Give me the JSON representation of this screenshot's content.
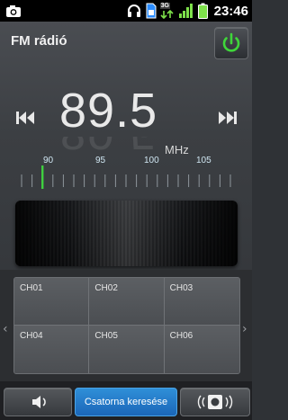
{
  "status_bar": {
    "time": "23:46",
    "network_label": "3G",
    "icons": [
      "camera-icon",
      "headphones-icon",
      "sim-card-icon",
      "network-3g-icon",
      "signal-icon",
      "battery-icon"
    ]
  },
  "app": {
    "title": "FM rádió",
    "frequency": "89.5",
    "unit": "MHz",
    "scale_labels": [
      "90",
      "95",
      "100",
      "105"
    ],
    "tuned_frequency_mhz": 89.5
  },
  "presets": [
    "CH01",
    "CH02",
    "CH03",
    "CH04",
    "CH05",
    "CH06"
  ],
  "bottom": {
    "scan_label": "Csatorna keresése"
  },
  "colors": {
    "power_green": "#3fd63a",
    "tuner_needle": "#3fcf3f",
    "scan_blue": "#2478c8"
  }
}
